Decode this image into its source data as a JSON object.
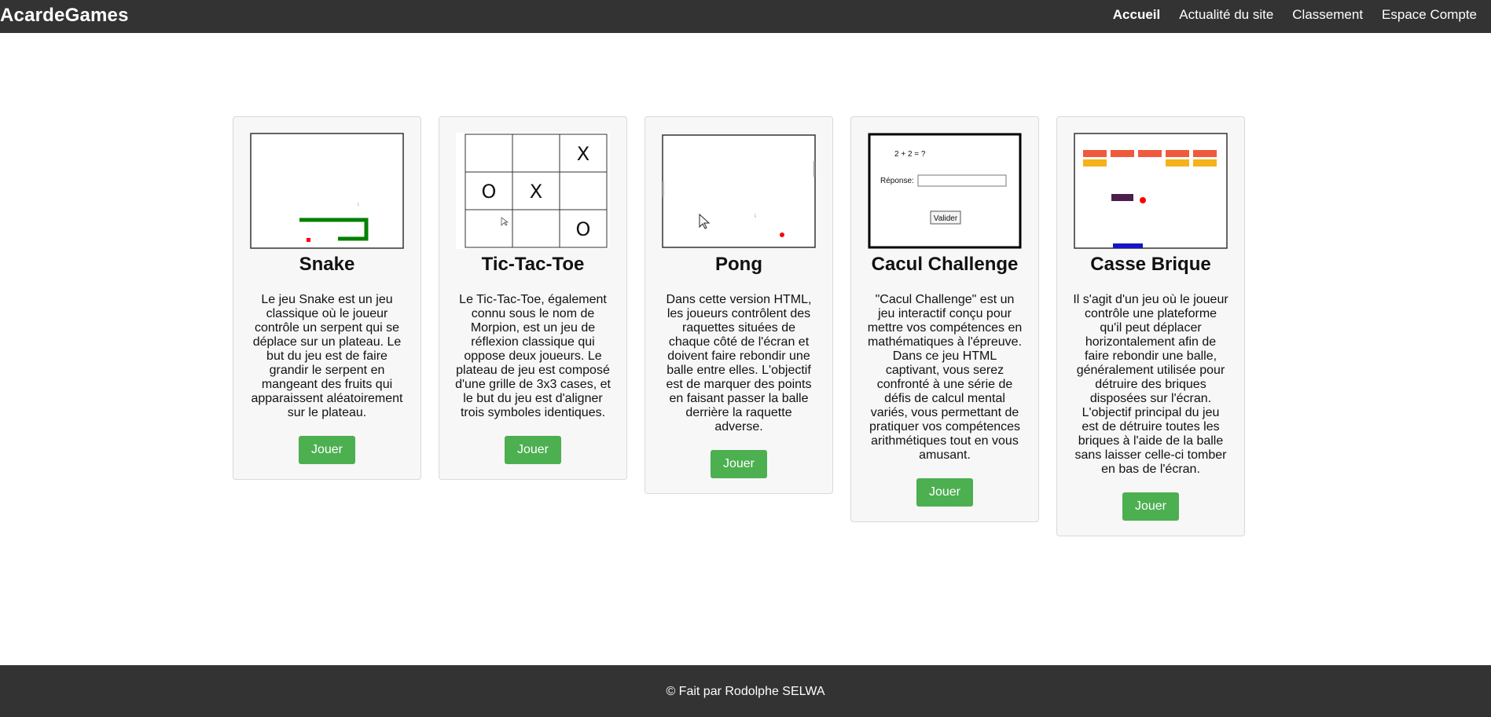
{
  "header": {
    "brand": "AcardeGames",
    "nav": [
      {
        "label": "Accueil",
        "active": true
      },
      {
        "label": "Actualité du site",
        "active": false
      },
      {
        "label": "Classement",
        "active": false
      },
      {
        "label": "Espace Compte",
        "active": false
      }
    ]
  },
  "games": [
    {
      "title": "Snake",
      "description": "Le jeu Snake est un jeu classique où le joueur contrôle un serpent qui se déplace sur un plateau. Le but du jeu est de faire grandir le serpent en mangeant des fruits qui apparaissent aléatoirement sur le plateau.",
      "button": "Jouer"
    },
    {
      "title": "Tic-Tac-Toe",
      "description": "Le Tic-Tac-Toe, également connu sous le nom de Morpion, est un jeu de réflexion classique qui oppose deux joueurs. Le plateau de jeu est composé d'une grille de 3x3 cases, et le but du jeu est d'aligner trois symboles identiques.",
      "button": "Jouer",
      "grid": [
        "",
        "",
        "X",
        "O",
        "X",
        "",
        "",
        "",
        "O"
      ]
    },
    {
      "title": "Pong",
      "description": "Dans cette version HTML, les joueurs contrôlent des raquettes situées de chaque côté de l'écran et doivent faire rebondir une balle entre elles. L'objectif est de marquer des points en faisant passer la balle derrière la raquette adverse.",
      "button": "Jouer"
    },
    {
      "title": "Cacul Challenge",
      "description": "\"Cacul Challenge\" est un jeu interactif conçu pour mettre vos compétences en mathématiques à l'épreuve. Dans ce jeu HTML captivant, vous serez confronté à une série de défis de calcul mental variés, vous permettant de pratiquer vos compétences arithmétiques tout en vous amusant.",
      "button": "Jouer",
      "preview": {
        "question": "2 + 2 = ?",
        "label": "Réponse:",
        "submit": "Valider"
      }
    },
    {
      "title": "Casse Brique",
      "description": "Il s'agit d'un jeu où le joueur contrôle une plateforme qu'il peut déplacer horizontalement afin de faire rebondir une balle, généralement utilisée pour détruire des briques disposées sur l'écran. L'objectif principal du jeu est de détruire toutes les briques à l'aide de la balle sans laisser celle-ci tomber en bas de l'écran.",
      "button": "Jouer"
    }
  ],
  "footer": {
    "text": "© Fait par Rodolphe SELWA"
  },
  "colors": {
    "header_bg": "#333333",
    "button_bg": "#4caf50",
    "snake_green": "#008000",
    "fruit_red": "#ff0000",
    "brick_red": "#f05a3c",
    "brick_yellow": "#f5b21a",
    "paddle_blue": "#1515c8",
    "brick_dark": "#4b1f4b"
  }
}
